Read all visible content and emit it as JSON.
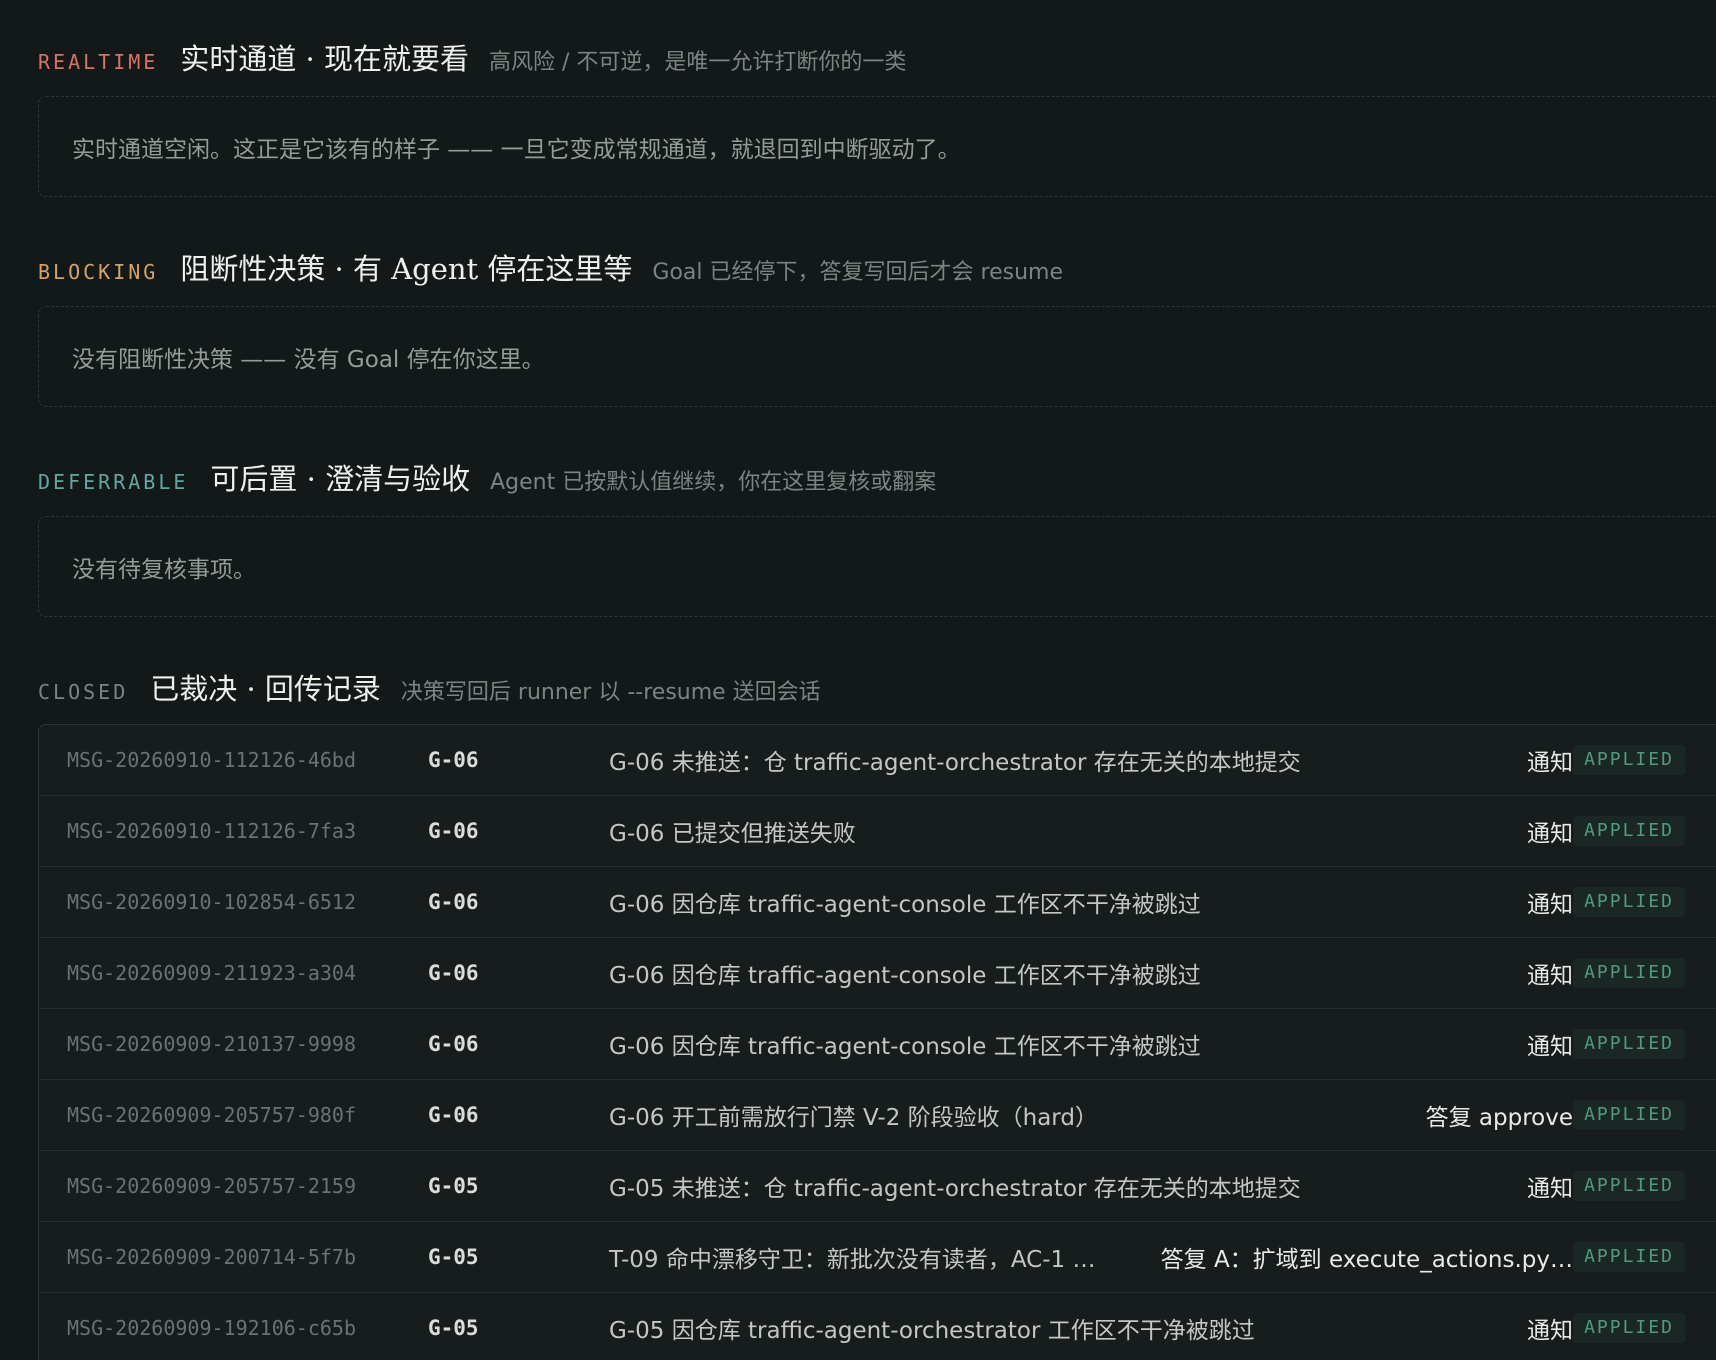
{
  "sections": {
    "realtime": {
      "tag": "REALTIME",
      "title": "实时通道 · 现在就要看",
      "desc": "高风险 / 不可逆，是唯一允许打断你的一类",
      "empty": "实时通道空闲。这正是它该有的样子 —— 一旦它变成常规通道，就退回到中断驱动了。",
      "tag_color": "#d9735e"
    },
    "blocking": {
      "tag": "BLOCKING",
      "title": "阻断性决策 · 有 Agent 停在这里等",
      "desc": "Goal 已经停下，答复写回后才会 resume",
      "empty": "没有阻断性决策 —— 没有 Goal 停在你这里。",
      "tag_color": "#d9a25e"
    },
    "deferrable": {
      "tag": "DEFERRABLE",
      "title": "可后置 · 澄清与验收",
      "desc": "Agent 已按默认值继续，你在这里复核或翻案",
      "empty": "没有待复核事项。",
      "tag_color": "#5fa9a3"
    },
    "closed": {
      "tag": "CLOSED",
      "title": "已裁决 · 回传记录",
      "desc": "决策写回后 runner 以 --resume 送回会话",
      "tag_color": "#7d8382"
    }
  },
  "closed_rows": [
    {
      "id": "MSG-20260910-112126-46bd",
      "goal": "G-06",
      "text": "G-06 未推送：仓 traffic-agent-orchestrator 存在无关的本地提交",
      "action": "通知",
      "status": "APPLIED"
    },
    {
      "id": "MSG-20260910-112126-7fa3",
      "goal": "G-06",
      "text": "G-06 已提交但推送失败",
      "action": "通知",
      "status": "APPLIED"
    },
    {
      "id": "MSG-20260910-102854-6512",
      "goal": "G-06",
      "text": "G-06 因仓库 traffic-agent-console 工作区不干净被跳过",
      "action": "通知",
      "status": "APPLIED"
    },
    {
      "id": "MSG-20260909-211923-a304",
      "goal": "G-06",
      "text": "G-06 因仓库 traffic-agent-console 工作区不干净被跳过",
      "action": "通知",
      "status": "APPLIED"
    },
    {
      "id": "MSG-20260909-210137-9998",
      "goal": "G-06",
      "text": "G-06 因仓库 traffic-agent-console 工作区不干净被跳过",
      "action": "通知",
      "status": "APPLIED"
    },
    {
      "id": "MSG-20260909-205757-980f",
      "goal": "G-06",
      "text": "G-06 开工前需放行门禁 V-2 阶段验收（hard）",
      "action": "答复 approve",
      "status": "APPLIED"
    },
    {
      "id": "MSG-20260909-205757-2159",
      "goal": "G-05",
      "text": "G-05 未推送：仓 traffic-agent-orchestrator 存在无关的本地提交",
      "action": "通知",
      "status": "APPLIED"
    },
    {
      "id": "MSG-20260909-200714-5f7b",
      "goal": "G-05",
      "text": "T-09 命中漂移守卫：新批次没有读者，AC-1 …",
      "action": "答复 A：扩域到 execute_actions.py…",
      "status": "APPLIED"
    },
    {
      "id": "MSG-20260909-192106-c65b",
      "goal": "G-05",
      "text": "G-05 因仓库 traffic-agent-orchestrator 工作区不干净被跳过",
      "action": "通知",
      "status": "APPLIED"
    }
  ]
}
